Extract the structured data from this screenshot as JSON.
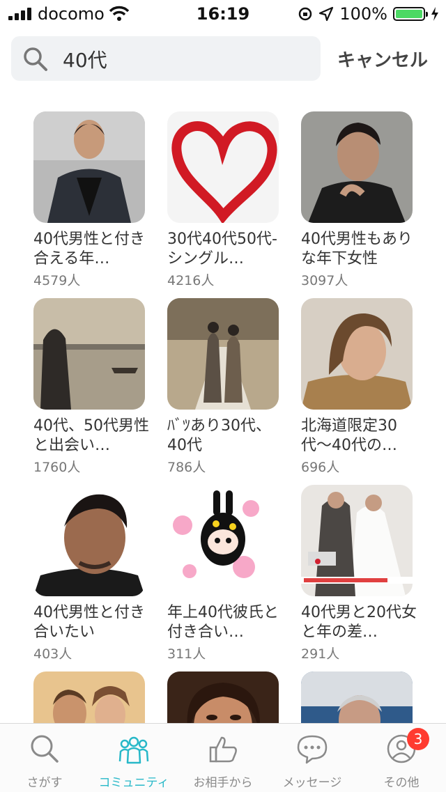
{
  "status_bar": {
    "carrier": "docomo",
    "time": "16:19",
    "battery": "100%"
  },
  "search": {
    "query": "40代",
    "cancel_label": "キャンセル"
  },
  "communities": [
    {
      "title": "40代男性と付き合える年…",
      "members": "4579人"
    },
    {
      "title": "30代40代50代-シングル…",
      "members": "4216人"
    },
    {
      "title": "40代男性もありな年下女性",
      "members": "3097人"
    },
    {
      "title": "40代、50代男性と出会い…",
      "members": "1760人"
    },
    {
      "title": "ﾊﾞﾂあり30代、40代",
      "members": "786人"
    },
    {
      "title": "北海道限定30代〜40代の…",
      "members": "696人"
    },
    {
      "title": "40代男性と付き合いたい",
      "members": "403人"
    },
    {
      "title": "年上40代彼氏と付き合い…",
      "members": "311人"
    },
    {
      "title": "40代男と20代女と年の差…",
      "members": "291人"
    },
    {
      "title": "",
      "members": ""
    },
    {
      "title": "",
      "members": ""
    },
    {
      "title": "",
      "members": ""
    }
  ],
  "tabs": [
    {
      "label": "さがす",
      "icon": "search-icon"
    },
    {
      "label": "コミュニティ",
      "icon": "community-icon"
    },
    {
      "label": "お相手から",
      "icon": "thumbs-up-icon"
    },
    {
      "label": "メッセージ",
      "icon": "message-icon"
    },
    {
      "label": "その他",
      "icon": "profile-icon",
      "badge": "3"
    }
  ],
  "colors": {
    "accent": "#27b8c8",
    "badge": "#ff3b30",
    "battery": "#4cd964"
  }
}
